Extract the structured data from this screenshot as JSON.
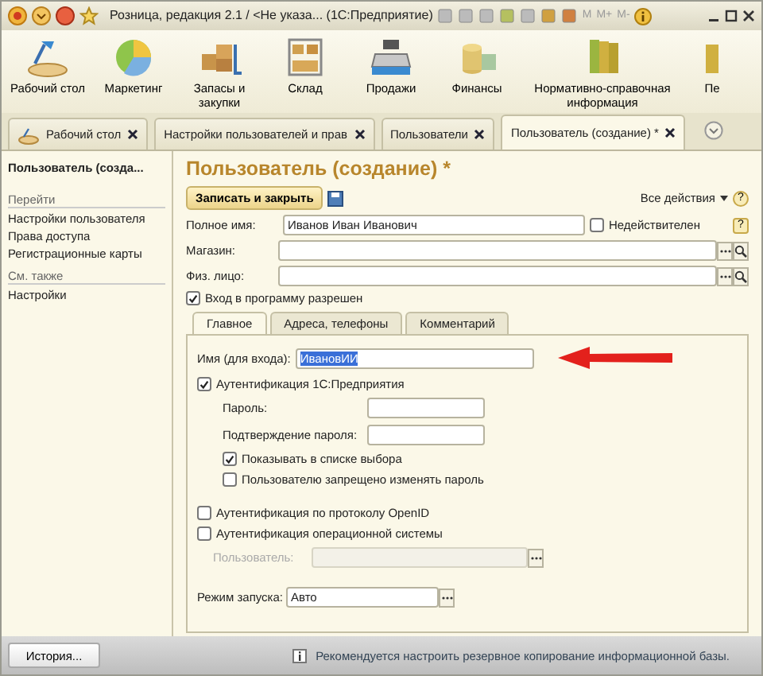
{
  "window": {
    "title": "Розница, редакция 2.1 / <Не указа...  (1С:Предприятие)",
    "memory_buttons": [
      "M",
      "M+",
      "M-"
    ]
  },
  "sections": [
    {
      "label": "Рабочий стол"
    },
    {
      "label": "Маркетинг"
    },
    {
      "label": "Запасы и закупки"
    },
    {
      "label": "Склад"
    },
    {
      "label": "Продажи"
    },
    {
      "label": "Финансы"
    },
    {
      "label": "Нормативно-справочная информация"
    },
    {
      "label": "Пе"
    }
  ],
  "open_tabs": [
    {
      "label": "Рабочий стол",
      "selected": false
    },
    {
      "label": "Настройки пользователей и прав",
      "selected": false
    },
    {
      "label": "Пользователи",
      "selected": false
    },
    {
      "label": "Пользователь (создание) *",
      "selected": true
    }
  ],
  "nav_panel": {
    "header": "Пользователь (созда...",
    "groups": [
      {
        "title": "Перейти",
        "items": [
          "Настройки пользователя",
          "Права доступа",
          "Регистрационные карты"
        ]
      },
      {
        "title": "См. также",
        "items": [
          "Настройки"
        ]
      }
    ]
  },
  "form": {
    "title": "Пользователь (создание) *",
    "save_button": "Записать и закрыть",
    "all_actions": "Все действия",
    "help": "?",
    "full_name": {
      "label": "Полное имя:",
      "value": "Иванов Иван Иванович"
    },
    "invalid": {
      "label": "Недействителен",
      "checked": false,
      "help": "?"
    },
    "choice_fields": [
      {
        "label": "Магазин:"
      },
      {
        "label": "Физ. лицо:"
      }
    ],
    "login_allowed": {
      "label": "Вход в программу разрешен",
      "checked": true
    },
    "tabs": [
      {
        "label": "Главное",
        "selected": true
      },
      {
        "label": "Адреса, телефоны",
        "selected": false
      },
      {
        "label": "Комментарий",
        "selected": false
      }
    ],
    "login_name": {
      "label": "Имя (для входа):",
      "value": "ИвановИИ",
      "text_selected": true
    },
    "rows": [
      {
        "kind": "check",
        "label": "Аутентификация 1С:Предприятия",
        "checked": true,
        "indent": false
      },
      {
        "kind": "field",
        "label": "Пароль:",
        "disabled": false
      },
      {
        "kind": "field",
        "label": "Подтверждение пароля:",
        "disabled": false
      },
      {
        "kind": "check",
        "label": "Показывать в списке выбора",
        "checked": true,
        "indent": true
      },
      {
        "kind": "check",
        "label": "Пользователю запрещено изменять пароль",
        "checked": false,
        "indent": true
      },
      {
        "kind": "gap"
      },
      {
        "kind": "check",
        "label": "Аутентификация по протоколу OpenID",
        "checked": false,
        "indent": false
      },
      {
        "kind": "check",
        "label": "Аутентификация операционной системы",
        "checked": false,
        "indent": false
      },
      {
        "kind": "picker",
        "label": "Пользователь:",
        "disabled": true
      },
      {
        "kind": "gap"
      },
      {
        "kind": "launch",
        "label": "Режим запуска:",
        "value": "Авто",
        "disabled": false
      }
    ]
  },
  "status_bar": {
    "history_button": "История...",
    "message": "Рекомендуется настроить резервное копирование информационной базы."
  }
}
